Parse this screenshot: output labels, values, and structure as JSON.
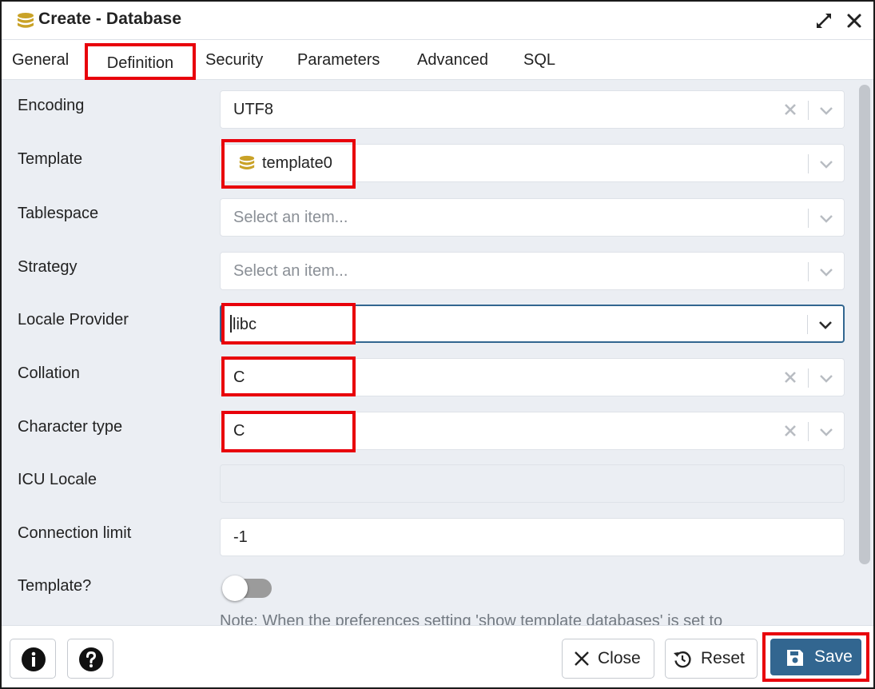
{
  "dialog": {
    "title": "Create - Database",
    "icon": "database-icon"
  },
  "tabs": [
    {
      "label": "General"
    },
    {
      "label": "Definition",
      "active": true
    },
    {
      "label": "Security"
    },
    {
      "label": "Parameters"
    },
    {
      "label": "Advanced"
    },
    {
      "label": "SQL"
    }
  ],
  "form": {
    "encoding": {
      "label": "Encoding",
      "value": "UTF8"
    },
    "template": {
      "label": "Template",
      "value": "template0",
      "icon": "database-icon"
    },
    "tablespace": {
      "label": "Tablespace",
      "placeholder": "Select an item..."
    },
    "strategy": {
      "label": "Strategy",
      "placeholder": "Select an item..."
    },
    "locale_provider": {
      "label": "Locale Provider",
      "value": "libc"
    },
    "collation": {
      "label": "Collation",
      "value": "C"
    },
    "character_type": {
      "label": "Character type",
      "value": "C"
    },
    "icu_locale": {
      "label": "ICU Locale",
      "value": ""
    },
    "connection_limit": {
      "label": "Connection limit",
      "value": "-1"
    },
    "is_template": {
      "label": "Template?",
      "checked": false
    },
    "note": "Note: When the preferences setting 'show template databases' is set to"
  },
  "footer": {
    "close_label": "Close",
    "reset_label": "Reset",
    "save_label": "Save"
  },
  "colors": {
    "highlight": "#e8000b",
    "primary": "#326690",
    "db_icon": "#c9a227"
  }
}
